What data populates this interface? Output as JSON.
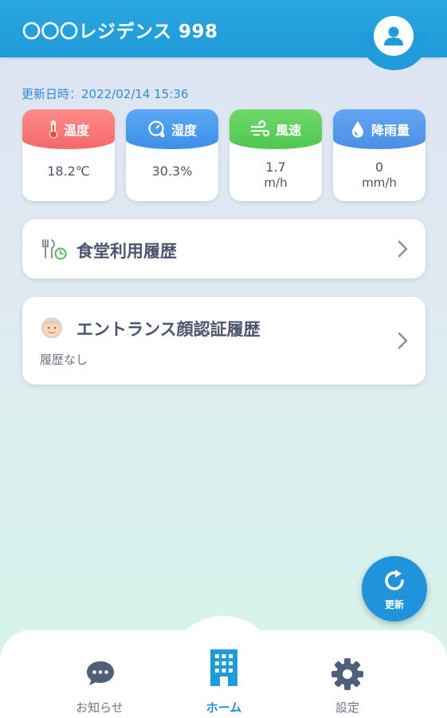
{
  "header": {
    "title": "〇〇〇レジデンス 998"
  },
  "updated": {
    "text": "更新日時：2022/02/14 15:36"
  },
  "weather": [
    {
      "label": "温度",
      "value": "18.2℃",
      "unit": "",
      "icon": "thermometer-icon"
    },
    {
      "label": "湿度",
      "value": "30.3%",
      "unit": "",
      "icon": "humidity-gauge-icon"
    },
    {
      "label": "風速",
      "value": "1.7",
      "unit": "m/h",
      "icon": "wind-icon"
    },
    {
      "label": "降雨量",
      "value": "0",
      "unit": "mm/h",
      "icon": "raindrop-icon"
    }
  ],
  "history": {
    "cafeteria": {
      "title": "食堂利用履歴",
      "icon": "cutlery-clock-icon"
    },
    "entrance": {
      "title": "エントランス顔認証履歴",
      "subtitle": "履歴なし",
      "icon": "face-icon"
    }
  },
  "refresh": {
    "label": "更新"
  },
  "nav": {
    "items": [
      {
        "label": "お知らせ",
        "icon": "chat-bubble-icon"
      },
      {
        "label": "ホーム",
        "icon": "building-icon"
      },
      {
        "label": "設定",
        "icon": "gear-icon"
      }
    ]
  },
  "colors": {
    "header": "#1e9bd9",
    "accent": "#1f94dc",
    "temp": "#f36a6a",
    "humidity": "#3e8fea",
    "wind": "#4fc751",
    "rain": "#4a8fe6"
  }
}
